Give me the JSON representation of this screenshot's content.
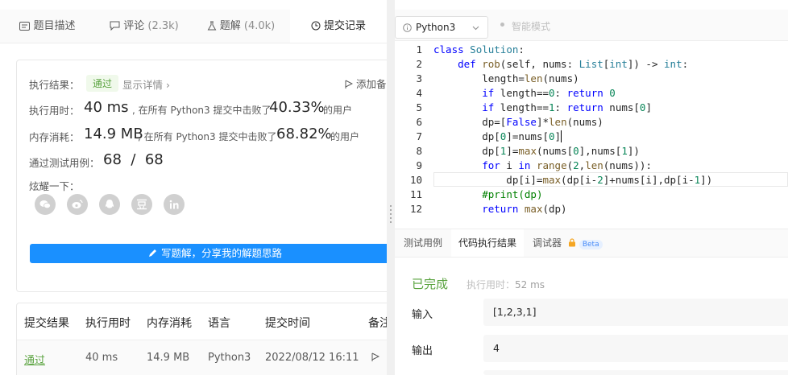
{
  "tabs": [
    {
      "label": "题目描述",
      "count": ""
    },
    {
      "label": "评论",
      "count": "(2.3k)"
    },
    {
      "label": "题解",
      "count": "(4.0k)"
    },
    {
      "label": "提交记录",
      "count": ""
    }
  ],
  "result": {
    "label": "执行结果：",
    "status": "通过",
    "details_link": "显示详情",
    "add_note": "添加备",
    "runtime_label": "执行用时：",
    "runtime_value": "40 ms",
    "runtime_text": ", 在所有 Python3 提交中击败了",
    "runtime_percent": "40.33%",
    "runtime_suffix": "的用户",
    "memory_label": "内存消耗：",
    "memory_value": "14.9 MB",
    "memory_text": ", 在所有 Python3 提交中击败了",
    "memory_percent": "68.82%",
    "memory_suffix": "的用户",
    "tests_label": "通过测试用例：",
    "tests_value": "68  /  68",
    "share_label": "炫耀一下：",
    "share_button": "写题解，分享我的解题思路"
  },
  "share_icons": [
    "wechat-icon",
    "weibo-icon",
    "qq-icon",
    "douban-icon",
    "linkedin-icon"
  ],
  "table": {
    "headers": [
      "提交结果",
      "执行用时",
      "内存消耗",
      "语言",
      "提交时间",
      "备注"
    ],
    "rows": [
      {
        "result": "通过",
        "runtime": "40 ms",
        "memory": "14.9 MB",
        "lang": "Python3",
        "time": "2022/08/12 16:11"
      }
    ]
  },
  "editor": {
    "language": "Python3",
    "smart_mode": "智能模式",
    "line_numbers": [
      "1",
      "2",
      "3",
      "4",
      "5",
      "6",
      "7",
      "8",
      "9",
      "10",
      "11",
      "12"
    ]
  },
  "bottom_tabs": [
    "测试用例",
    "代码执行结果",
    "调试器"
  ],
  "beta": "Beta",
  "run": {
    "status": "已完成",
    "time_label": "执行用时：",
    "time_value": "52 ms",
    "input_label": "输入",
    "input_value": "[1,2,3,1]",
    "output_label": "输出",
    "output_value": "4"
  },
  "colors": {
    "accent": "#1a90ff",
    "success": "#5aa33f"
  }
}
